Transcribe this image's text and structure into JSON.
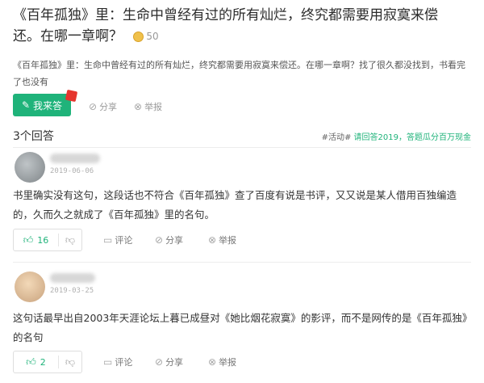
{
  "question": {
    "title": "《百年孤独》里：生命中曾经有过的所有灿烂，终究都需要用寂寞来偿还。在哪一章啊？",
    "coin_value": "50",
    "description": "《百年孤独》里：生命中曾经有过的所有灿烂，终究都需要用寂寞来偿还。在哪一章啊？找了很久都没找到，书看完了也没有",
    "answer_button_label": "我来答",
    "share_label": "分享",
    "report_label": "举报"
  },
  "answers_header": {
    "count_label": "3个回答",
    "promo_tag": "#活动#",
    "promo_text": "请回答2019，答题瓜分百万现金"
  },
  "answers": [
    {
      "date": "2019-06-06",
      "text": "书里确实没有这句，这段话也不符合《百年孤独》查了百度有说是书评，又又说是某人借用百独编造的，久而久之就成了《百年孤独》里的名句。",
      "votes": "16",
      "comment_label": "评论",
      "share_label": "分享",
      "report_label": "举报"
    },
    {
      "date": "2019-03-25",
      "text": "这句话最早出自2003年天涯论坛上暮已成昼对《她比烟花寂寞》的影评，而不是网传的是《百年孤独》的名句",
      "votes": "2",
      "comment_label": "评论",
      "share_label": "分享",
      "report_label": "举报"
    }
  ],
  "icons": {
    "thumb_up": "thumb-up-icon",
    "thumb_down": "thumb-down-icon",
    "comment": "comment-icon",
    "share": "share-icon",
    "report": "report-icon",
    "pencil": "pencil-icon",
    "coin": "coin-icon"
  },
  "colors": {
    "accent": "#1fb37a",
    "coin": "#e3a82b",
    "badge": "#e5362e"
  }
}
